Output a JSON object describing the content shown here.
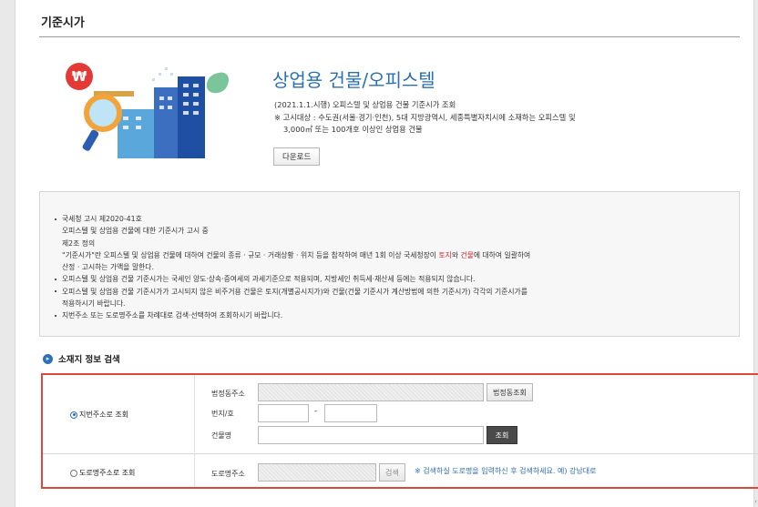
{
  "page": {
    "title": "기준시가"
  },
  "hero": {
    "title": "상업용 건물/오피스텔",
    "desc_line1": "(2021.1.1.시행) 오피스텔 및 상업용 건물 기준시가 조회",
    "desc_line2": "※ 고시대상 : 수도권(서울·경기·인천), 5대 지방광역시, 세종특별자치시에 소재하는 오피스텔 및",
    "desc_line3": "3,000㎡ 또는 100개호 이상인 상업용 건물",
    "download_label": "다운로드"
  },
  "notice": {
    "item1_line1": "국세청 고시 제2020-41호",
    "item1_line2": "오피스텔 및 상업용 건물에 대한 기준시가 고시 중",
    "item1_line3": "제2조 정의",
    "item1_line4_pre": "\"기준시가\"란 오피스텔 및 상업용 건물에 대하여 건물의 종류 · 규모 · 거래상황 · 위치 등을 참작하여 매년 1회 이상 국세청장이 ",
    "item1_line4_red1": "토지",
    "item1_line4_mid": "와 ",
    "item1_line4_red2": "건물",
    "item1_line4_post": "에 대하여 일괄하여",
    "item1_line5": "산정 · 고시하는 가액을 말한다.",
    "item2": "오피스텔 및 상업용 건물 기준시가는 국세인 양도·상속·증여세의 과세기준으로 적용되며, 지방세인 취득세·재산세 등에는 적용되지 않습니다.",
    "item3_line1": "오피스텔 및 상업용 건물 기준시가가 고시되지 않은 비주거용 건물은 토지(개별공시지가)와 건물(건물 기준시가 계산방법에 의한 기준시가) 각각의 기준시가를",
    "item3_line2": "적용하시기 바랍니다.",
    "item4": "지번주소 또는 도로명주소를 차례대로 검색·선택하여 조회하시기 바랍니다."
  },
  "search": {
    "section_title": "소재지 정보 검색",
    "option_jibun": "지번주소로 조회",
    "option_road": "도로명주소로 조회",
    "label_dong": "법정동주소",
    "btn_dong": "법정동조회",
    "label_bunji": "번지/호",
    "dash": "-",
    "label_building": "건물명",
    "btn_search": "조회",
    "label_road": "도로명주소",
    "btn_road": "검색",
    "road_hint": "※ 검색하실 도로명을 입력하신 후 검색하세요. 예) 강남대로"
  },
  "colors": {
    "accent": "#2d71b8",
    "highlight_border": "#e0463c",
    "red_text": "#d0262b"
  },
  "icons": [
    "won-coin-icon",
    "magnifier-icon",
    "building-icon",
    "leaf-icon",
    "circle-arrow-icon"
  ]
}
